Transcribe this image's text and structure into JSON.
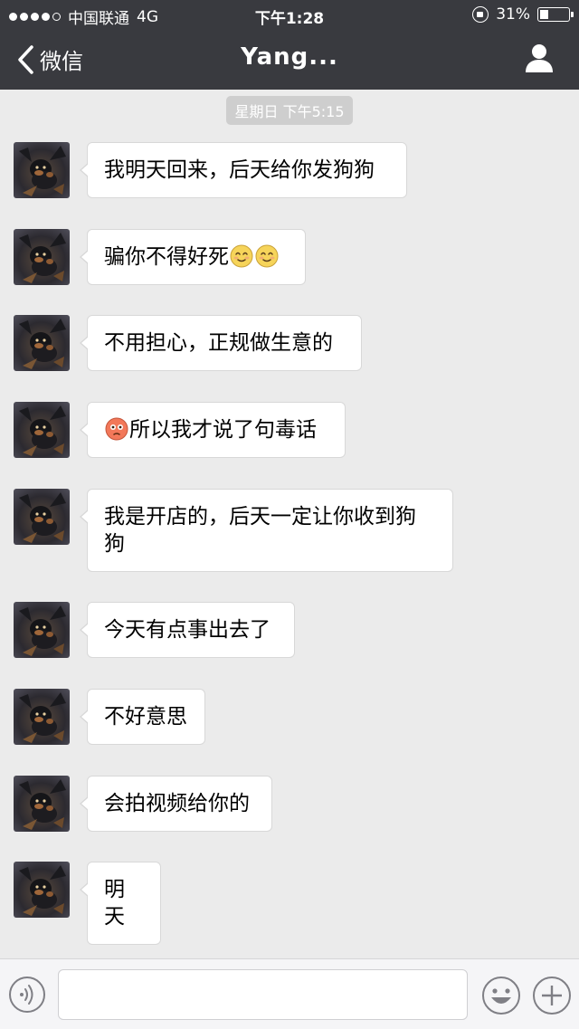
{
  "status_bar": {
    "carrier": "中国联通",
    "network": "4G",
    "time": "下午1:28",
    "battery": "31%",
    "battery_level": 0.31
  },
  "nav": {
    "back_label": "微信",
    "title": "Yang...",
    "profile_icon": "person-icon"
  },
  "timestamp": "星期日 下午5:15",
  "messages": [
    {
      "text": "我明天回来，后天给你发狗狗"
    },
    {
      "text": "骗你不得好死",
      "trailing_emoji": [
        "smile-emoji",
        "smile-emoji"
      ]
    },
    {
      "text": "不用担心，正规做生意的"
    },
    {
      "text": "所以我才说了句毒话",
      "leading_emoji": [
        "flushed-emoji"
      ]
    },
    {
      "text": "我是开店的，后天一定让你收到狗狗"
    },
    {
      "text": "今天有点事出去了"
    },
    {
      "text": "不好意思"
    },
    {
      "text": "会拍视频给你的"
    },
    {
      "text": "明天"
    }
  ],
  "input_bar": {
    "placeholder": "",
    "voice_icon": "voice-icon",
    "emoji_icon": "emoji-icon",
    "plus_icon": "plus-icon"
  },
  "colors": {
    "topbar": "#393a3f",
    "background": "#ebebeb",
    "bubble": "#ffffff",
    "timestamp_bg": "#cecece"
  }
}
